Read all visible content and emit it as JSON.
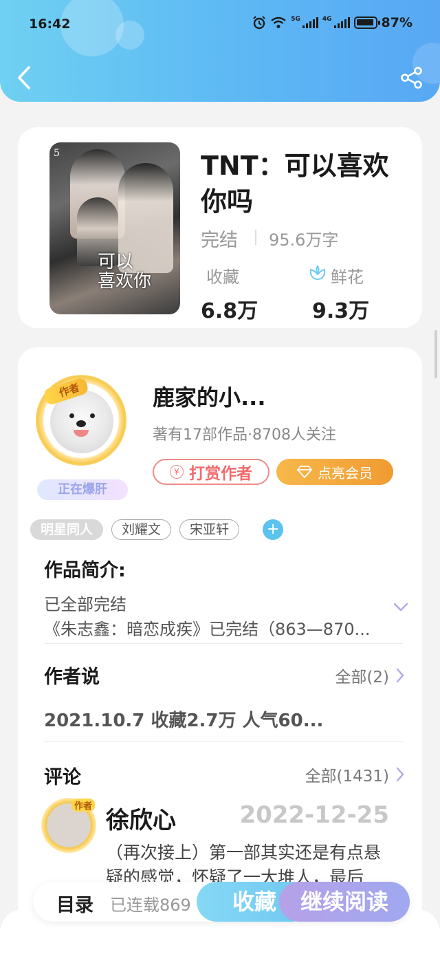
{
  "status_bar": {
    "time": "16:42",
    "network1": "5G",
    "network2": "4G",
    "battery": "87%"
  },
  "book": {
    "title": "TNT：可以喜欢你吗",
    "status": "完结",
    "words": "95.6万字",
    "favorites_label": "收藏",
    "favorites_value": "6.8万",
    "flowers_label": "鲜花",
    "flowers_value": "9.3万",
    "cover": {
      "number": "5",
      "title_line1": "可以",
      "title_line2": "喜欢你"
    }
  },
  "author": {
    "badge": "作者",
    "hot_label": "正在爆肝",
    "name": "鹿家的小...",
    "meta": "著有17部作品·8708人关注",
    "tip_button": "打赏作者",
    "vip_button": "点亮会员"
  },
  "tags": [
    "明星同人",
    "刘耀文",
    "宋亚轩"
  ],
  "intro": {
    "title": "作品简介:",
    "line1": "已全部完结",
    "line2": "《朱志鑫：暗恋成疾》已完结（863—870..."
  },
  "author_says": {
    "title": "作者说",
    "more": "全部(2)",
    "content": "2021.10.7  收藏2.7万  人气60..."
  },
  "comments": {
    "title": "评论",
    "more": "全部(1431)",
    "first": {
      "badge": "作者",
      "user": "徐欣心",
      "date": "2022-12-25",
      "text": "（再次接上）第一部其实还是有点悬疑的感觉，怀疑了一大堆人，最后"
    }
  },
  "bottom_bar": {
    "toc": "目录",
    "serial": "已连载869",
    "favorite_button": "收藏",
    "read_button": "继续阅读"
  },
  "colors": {
    "header_start": "#6fd0f2",
    "header_end": "#58a8f4",
    "tip": "#f06b6b",
    "vip": "#f09b32",
    "read": "#b6a1e8"
  }
}
